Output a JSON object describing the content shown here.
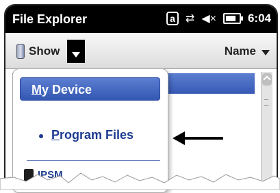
{
  "status_bar": {
    "app_title": "File Explorer",
    "icons": [
      "a-keyboard-icon",
      "sync-arrows-icon",
      "speaker-mute-icon",
      "battery-icon"
    ],
    "time": "6:04"
  },
  "toolbar": {
    "show_label": "Show",
    "name_label": "Name"
  },
  "dropdown": {
    "my_device_underline": "M",
    "my_device_rest": "y Device",
    "program_files_underline": "P",
    "program_files_rest": "rogram Files",
    "ipsm_label": "IPSM"
  },
  "colors": {
    "selection_blue": "#3759b5",
    "menu_text_blue": "#1d3b8f",
    "status_bar_black": "#000000"
  }
}
